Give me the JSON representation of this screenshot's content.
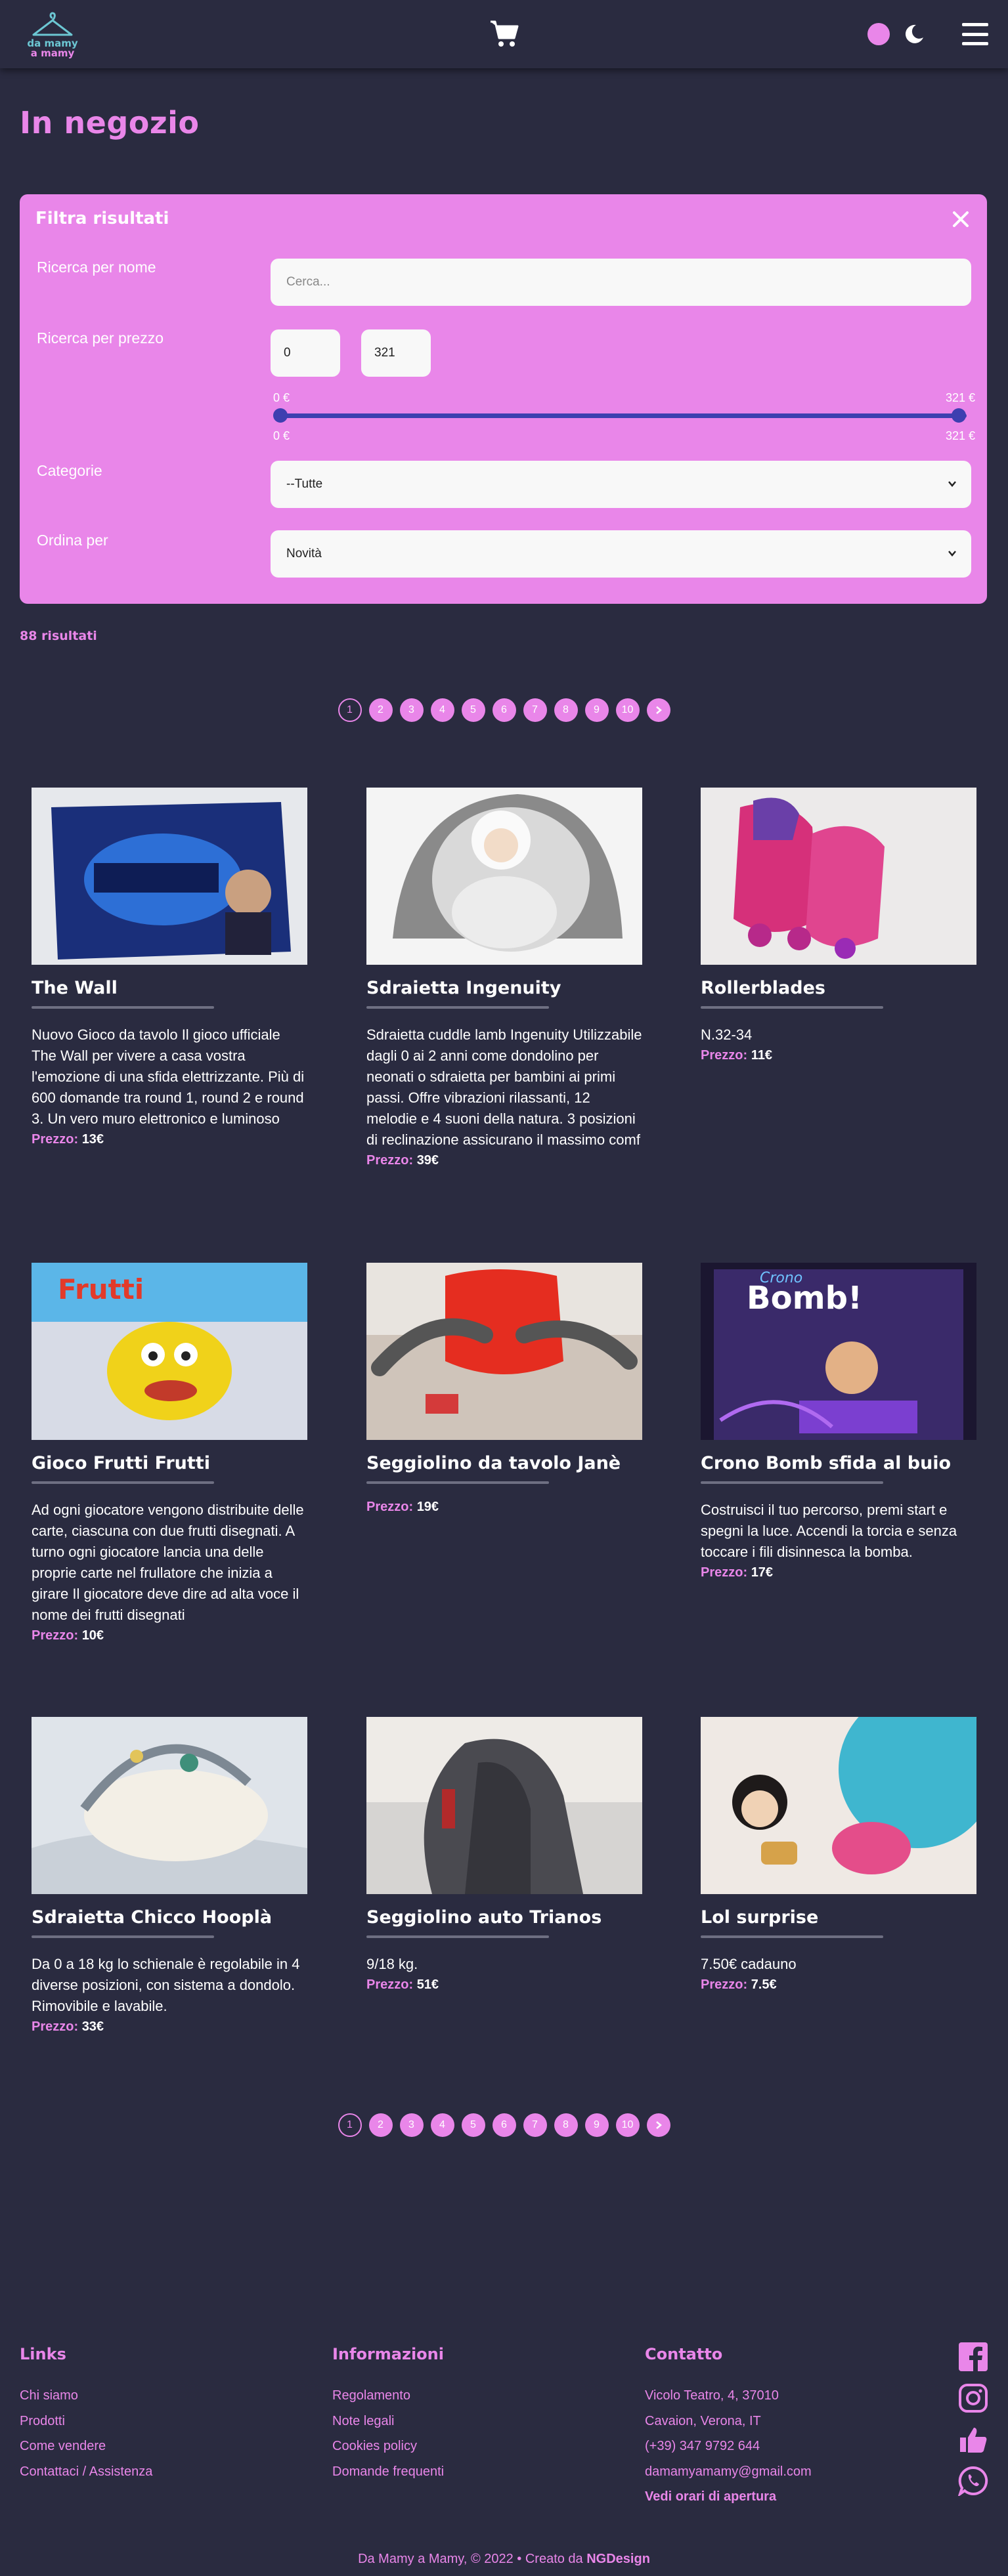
{
  "header": {
    "logo_line1": "da mamy",
    "logo_line2": "a mamy"
  },
  "page": {
    "title": "In negozio"
  },
  "filter": {
    "title": "Filtra risultati",
    "name_label": "Ricerca per nome",
    "name_placeholder": "Cerca...",
    "price_label": "Ricerca per prezzo",
    "price_min": "0",
    "price_max": "321",
    "range_min_label": "0 €",
    "range_max_label": "321 €",
    "category_label": "Categorie",
    "category_value": "--Tutte",
    "sort_label": "Ordina per",
    "sort_value": "Novità"
  },
  "results": {
    "count_text": "88 risultati"
  },
  "pagination": {
    "pages": [
      "1",
      "2",
      "3",
      "4",
      "5",
      "6",
      "7",
      "8",
      "9",
      "10"
    ],
    "current": 1,
    "next_icon": "chevron-right-icon"
  },
  "products": [
    {
      "title": "The Wall",
      "description": "Nuovo Gioco da tavolo Il gioco ufficiale The Wall per vivere a casa vostra l'emozione di una sfida elettrizzante. Più di 600 domande tra round 1, round 2 e round 3. Un vero muro elettronico e luminoso",
      "price_label": "Prezzo:",
      "price": "13€"
    },
    {
      "title": "Sdraietta Ingenuity",
      "description": "Sdraietta cuddle lamb Ingenuity Utilizzabile dagli 0 ai 2 anni come dondolino per neonati o sdraietta per bambini ai primi passi. Offre vibrazioni rilassanti, 12 melodie e 4 suoni della natura. 3 posizioni di reclinazione assicurano il massimo comf",
      "price_label": "Prezzo:",
      "price": "39€"
    },
    {
      "title": "Rollerblades",
      "description": "N.32-34",
      "price_label": "Prezzo:",
      "price": "11€"
    },
    {
      "title": "Gioco Frutti Frutti",
      "description": "Ad ogni giocatore vengono distribuite delle carte, ciascuna con due frutti disegnati. A turno ogni giocatore lancia una delle proprie carte nel frullatore che inizia a girare Il giocatore deve dire ad alta voce il nome dei frutti disegnati",
      "price_label": "Prezzo:",
      "price": "10€"
    },
    {
      "title": "Seggiolino da tavolo Janè",
      "description": "",
      "price_label": "Prezzo:",
      "price": "19€"
    },
    {
      "title": "Crono Bomb sfida al buio",
      "description": "Costruisci il tuo percorso, premi start e spegni la luce. Accendi la torcia e senza toccare i fili disinnesca la bomba.",
      "price_label": "Prezzo:",
      "price": "17€"
    },
    {
      "title": "Sdraietta Chicco Hooplà",
      "description": "Da 0 a 18 kg lo schienale è regolabile in 4 diverse posizioni, con sistema a dondolo. Rimovibile e lavabile.",
      "price_label": "Prezzo:",
      "price": "33€"
    },
    {
      "title": "Seggiolino auto Trianos",
      "description": "9/18 kg.",
      "price_label": "Prezzo:",
      "price": "51€"
    },
    {
      "title": "Lol surprise",
      "description": "7.50€ cadauno",
      "price_label": "Prezzo:",
      "price": "7.5€"
    }
  ],
  "footer": {
    "links_title": "Links",
    "links": [
      "Chi siamo",
      "Prodotti",
      "Come vendere",
      "Contattaci / Assistenza"
    ],
    "info_title": "Informazioni",
    "info": [
      "Regolamento",
      "Note legali",
      "Cookies policy",
      "Domande frequenti"
    ],
    "contact_title": "Contatto",
    "contact": [
      "Vicolo Teatro, 4, 37010",
      "Cavaion, Verona, IT",
      "(+39) 347 9792 644",
      "damamyamamy@gmail.com"
    ],
    "hours_link": "Vedi orari di apertura",
    "social_icons": [
      "facebook-icon",
      "instagram-icon",
      "thumbs-up-icon",
      "whatsapp-icon"
    ],
    "copyright_text": "Da Mamy a Mamy, © 2022 • Creato da",
    "copyright_brand": "NGDesign"
  },
  "colors": {
    "background": "#2a2b40",
    "accent": "#e986e9",
    "slider": "#3d3fb0"
  }
}
